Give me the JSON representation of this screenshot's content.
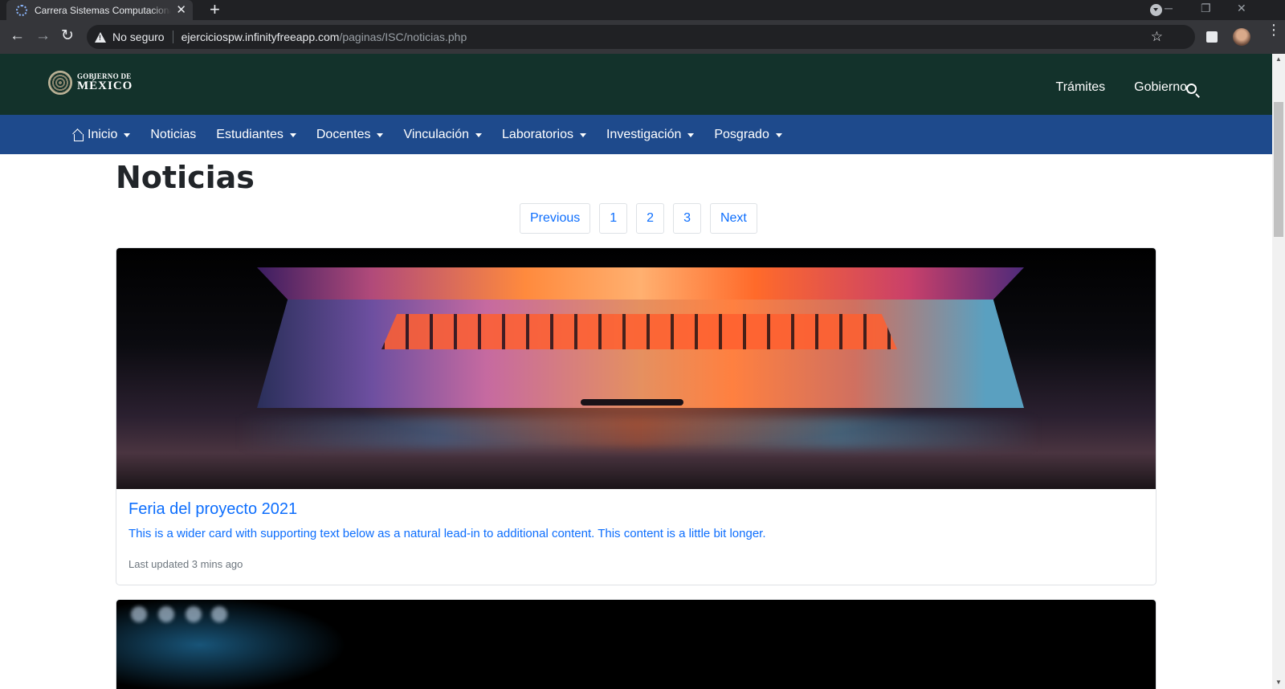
{
  "browser": {
    "tab_title": "Carrera Sistemas Computacionales",
    "security_label": "No seguro",
    "url_host": "ejerciciospw.infinityfreeapp.com",
    "url_path": "/paginas/ISC/noticias.php"
  },
  "gov_header": {
    "logo_small": "GOBIERNO DE",
    "logo_big": "MÉXICO",
    "links": [
      "Trámites",
      "Gobierno"
    ]
  },
  "nav": {
    "items": [
      {
        "label": "Inicio",
        "dropdown": true,
        "icon": "home-icon"
      },
      {
        "label": "Noticias",
        "dropdown": false
      },
      {
        "label": "Estudiantes",
        "dropdown": true
      },
      {
        "label": "Docentes",
        "dropdown": true
      },
      {
        "label": "Vinculación",
        "dropdown": true
      },
      {
        "label": "Laboratorios",
        "dropdown": true
      },
      {
        "label": "Investigación",
        "dropdown": true
      },
      {
        "label": "Posgrado",
        "dropdown": true
      }
    ]
  },
  "page": {
    "title": "Noticias"
  },
  "pagination": {
    "previous": "Previous",
    "pages": [
      "1",
      "2",
      "3"
    ],
    "next": "Next"
  },
  "cards": [
    {
      "title": "Feria del proyecto 2021",
      "text": "This is a wider card with supporting text below as a natural lead-in to additional content. This content is a little bit longer.",
      "meta": "Last updated 3 mins ago"
    }
  ],
  "colors": {
    "gov_bar": "#13322b",
    "nav_bar": "#1e4a8c",
    "link": "#0d6efd"
  }
}
